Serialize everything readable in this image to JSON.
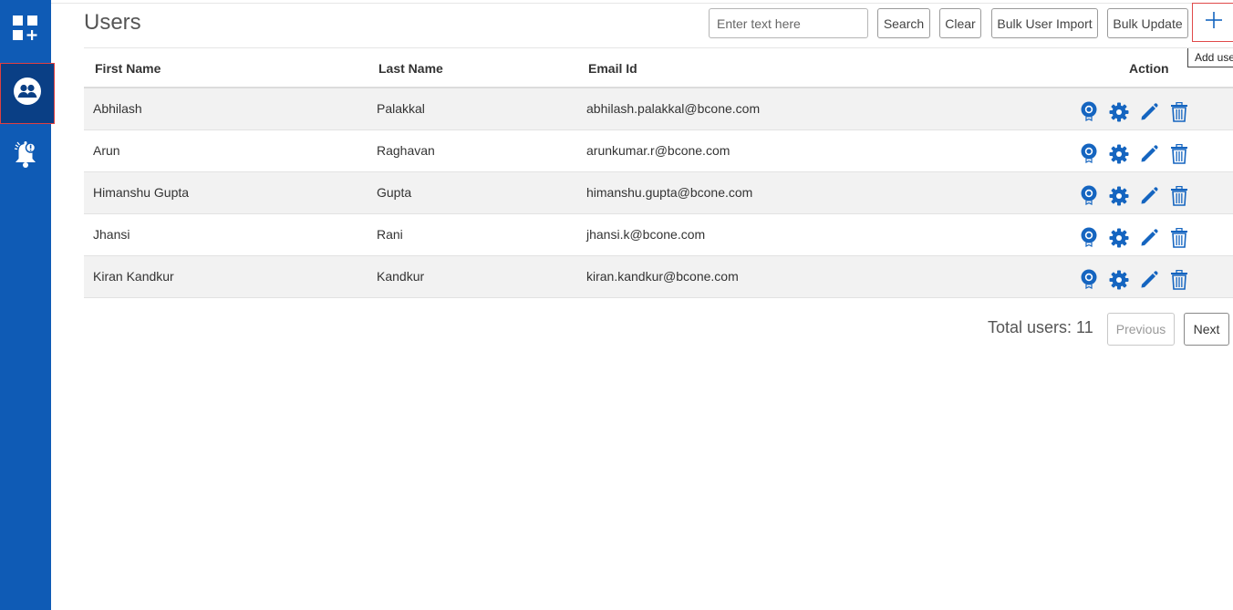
{
  "page": {
    "title": "Users"
  },
  "sidebar": {
    "items": [
      {
        "name": "dashboard",
        "icon": "apps-add-icon",
        "active": false
      },
      {
        "name": "users",
        "icon": "users-group-icon",
        "active": true
      },
      {
        "name": "alerts",
        "icon": "alert-bell-icon",
        "active": false
      }
    ]
  },
  "toolbar": {
    "search_placeholder": "Enter text here",
    "search_value": "",
    "search_label": "Search",
    "clear_label": "Clear",
    "bulk_import_label": "Bulk User Import",
    "bulk_update_label": "Bulk Update",
    "add_icon": "plus-icon",
    "add_tooltip": "Add user"
  },
  "table": {
    "headers": {
      "first_name": "First Name",
      "last_name": "Last Name",
      "email": "Email Id",
      "action": "Action"
    },
    "rows": [
      {
        "first_name": "Abhilash",
        "last_name": "Palakkal",
        "email": "abhilash.palakkal@bcone.com"
      },
      {
        "first_name": "Arun",
        "last_name": "Raghavan",
        "email": "arunkumar.r@bcone.com"
      },
      {
        "first_name": "Himanshu Gupta",
        "last_name": "Gupta",
        "email": "himanshu.gupta@bcone.com"
      },
      {
        "first_name": "Jhansi",
        "last_name": "Rani",
        "email": "jhansi.k@bcone.com"
      },
      {
        "first_name": "Kiran Kandkur",
        "last_name": "Kandkur",
        "email": "kiran.kandkur@bcone.com"
      }
    ],
    "action_icons": [
      "badge-icon",
      "gear-icon",
      "pencil-icon",
      "trash-icon"
    ]
  },
  "pagination": {
    "total_label": "Total users: 11",
    "previous_label": "Previous",
    "next_label": "Next"
  },
  "colors": {
    "sidebar": "#0f5bb5",
    "sidebar_active": "#0a3f85",
    "icon_blue": "#1565c0",
    "row_alt": "#f2f2f2",
    "highlight_border": "#e04a4a"
  }
}
